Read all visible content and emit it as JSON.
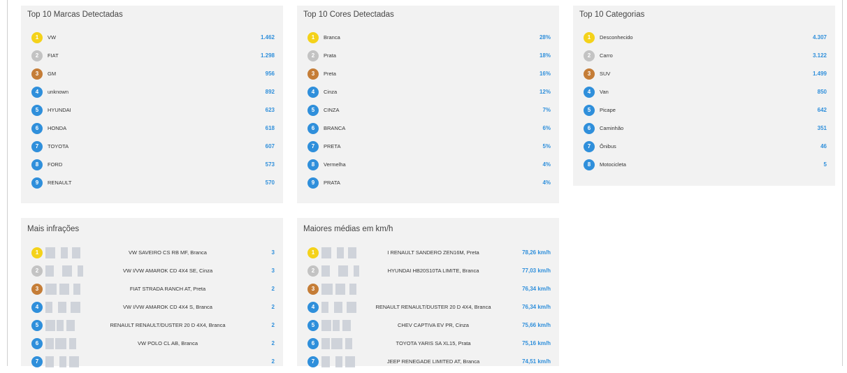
{
  "marcas": {
    "title": "Top 10 Marcas Detectadas",
    "items": [
      {
        "rank": "1",
        "label": "VW",
        "value": "1.462"
      },
      {
        "rank": "2",
        "label": "FIAT",
        "value": "1.298"
      },
      {
        "rank": "3",
        "label": "GM",
        "value": "956"
      },
      {
        "rank": "4",
        "label": "unknown",
        "value": "892"
      },
      {
        "rank": "5",
        "label": "HYUNDAI",
        "value": "623"
      },
      {
        "rank": "6",
        "label": "HONDA",
        "value": "618"
      },
      {
        "rank": "7",
        "label": "TOYOTA",
        "value": "607"
      },
      {
        "rank": "8",
        "label": "FORD",
        "value": "573"
      },
      {
        "rank": "9",
        "label": "RENAULT",
        "value": "570"
      }
    ]
  },
  "cores": {
    "title": "Top 10 Cores Detectadas",
    "items": [
      {
        "rank": "1",
        "label": "Branca",
        "value": "28%"
      },
      {
        "rank": "2",
        "label": "Prata",
        "value": "18%"
      },
      {
        "rank": "3",
        "label": "Preta",
        "value": "16%"
      },
      {
        "rank": "4",
        "label": "Cinza",
        "value": "12%"
      },
      {
        "rank": "5",
        "label": "CINZA",
        "value": "7%"
      },
      {
        "rank": "6",
        "label": "BRANCA",
        "value": "6%"
      },
      {
        "rank": "7",
        "label": "PRETA",
        "value": "5%"
      },
      {
        "rank": "8",
        "label": "Vermelha",
        "value": "4%"
      },
      {
        "rank": "9",
        "label": "PRATA",
        "value": "4%"
      }
    ]
  },
  "categorias": {
    "title": "Top 10 Categorias",
    "items": [
      {
        "rank": "1",
        "label": "Desconhecido",
        "value": "4.307"
      },
      {
        "rank": "2",
        "label": "Carro",
        "value": "3.122"
      },
      {
        "rank": "3",
        "label": "SUV",
        "value": "1.499"
      },
      {
        "rank": "4",
        "label": "Van",
        "value": "850"
      },
      {
        "rank": "5",
        "label": "Picape",
        "value": "642"
      },
      {
        "rank": "6",
        "label": "Caminhão",
        "value": "351"
      },
      {
        "rank": "7",
        "label": "Ônibus",
        "value": "46"
      },
      {
        "rank": "8",
        "label": "Motocicleta",
        "value": "5"
      }
    ]
  },
  "infracoes": {
    "title": "Mais infrações",
    "items": [
      {
        "rank": "1",
        "desc": "VW SAVEIRO CS RB MF, Branca",
        "value": "3"
      },
      {
        "rank": "2",
        "desc": "VW I/VW AMAROK CD 4X4 SE, Cinza",
        "value": "3"
      },
      {
        "rank": "3",
        "desc": "FIAT STRADA RANCH AT, Preta",
        "value": "2"
      },
      {
        "rank": "4",
        "desc": "VW I/VW AMAROK CD 4X4 S, Branca",
        "value": "2"
      },
      {
        "rank": "5",
        "desc": "RENAULT RENAULT/DUSTER 20 D 4X4, Branca",
        "value": "2"
      },
      {
        "rank": "6",
        "desc": "VW POLO CL AB, Branca",
        "value": "2"
      },
      {
        "rank": "7",
        "desc": "",
        "value": "2"
      }
    ]
  },
  "velocidades": {
    "title": "Maiores médias em km/h",
    "items": [
      {
        "rank": "1",
        "desc": "I RENAULT SANDERO ZEN16M, Preta",
        "value": "78,26 km/h"
      },
      {
        "rank": "2",
        "desc": "HYUNDAI HB20S10TA LIMITE, Branca",
        "value": "77,03 km/h"
      },
      {
        "rank": "3",
        "desc": "",
        "value": "76,34 km/h"
      },
      {
        "rank": "4",
        "desc": "RENAULT RENAULT/DUSTER 20 D 4X4, Branca",
        "value": "76,34 km/h"
      },
      {
        "rank": "5",
        "desc": "CHEV CAPTIVA EV PR, Cinza",
        "value": "75,66 km/h"
      },
      {
        "rank": "6",
        "desc": "TOYOTA YARIS SA XL15, Prata",
        "value": "75,16 km/h"
      },
      {
        "rank": "7",
        "desc": "JEEP RENEGADE LIMITED AT, Branca",
        "value": "74,51 km/h"
      }
    ]
  },
  "colors": {
    "gold": "#f4d21a",
    "silver": "#c3c3c3",
    "bronze": "#c57d37",
    "blue": "#2f8fdb",
    "panel": "#f2f2f2"
  }
}
